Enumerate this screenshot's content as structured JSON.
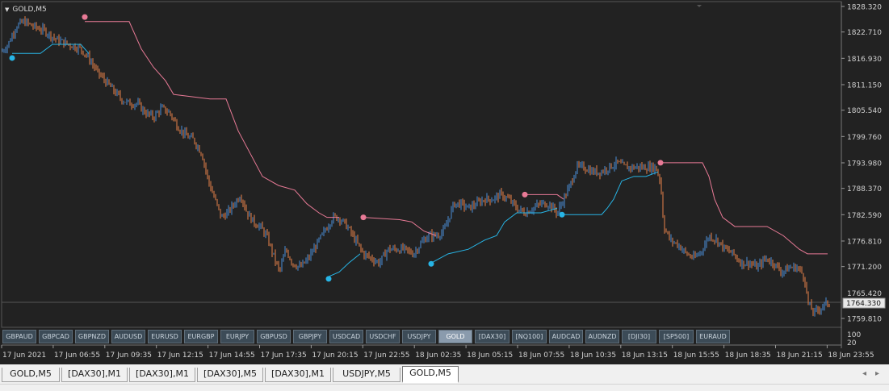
{
  "chart": {
    "title": "GOLD,M5",
    "current_price": "1764.330",
    "partial_price": "1765.420",
    "price_labels": [
      "1828.320",
      "1822.710",
      "1816.930",
      "1811.150",
      "1805.540",
      "1799.760",
      "1793.980",
      "1788.370",
      "1782.590",
      "1776.810",
      "1771.200",
      "1759.810"
    ],
    "time_labels": [
      "17 Jun 2021",
      "17 Jun 06:55",
      "17 Jun 09:35",
      "17 Jun 12:15",
      "17 Jun 14:55",
      "17 Jun 17:35",
      "17 Jun 20:15",
      "17 Jun 22:55",
      "18 Jun 02:35",
      "18 Jun 05:15",
      "18 Jun 07:55",
      "18 Jun 10:35",
      "18 Jun 13:15",
      "18 Jun 15:55",
      "18 Jun 18:35",
      "18 Jun 21:15",
      "18 Jun 23:55"
    ],
    "indicator_scale": [
      "100",
      "20"
    ],
    "colors": {
      "background": "#222222",
      "bull": "#4a8fd8",
      "bear": "#e8824a",
      "stop_up": "#27b5e6",
      "stop_down": "#e87a96"
    }
  },
  "symbols": [
    "GBPAUD",
    "GBPCAD",
    "GBPNZD",
    "AUDUSD",
    "EURUSD",
    "EURGBP",
    "EURJPY",
    "GBPUSD",
    "GBPJPY",
    "USDCAD",
    "USDCHF",
    "USDJPY",
    "GOLD",
    "[DAX30]",
    "[NQ100]",
    "AUDCAD",
    "AUDNZD",
    "[DJI30]",
    "[SP500]",
    "EURAUD"
  ],
  "active_symbol": "GOLD",
  "tabs": [
    "GOLD,M5",
    "[DAX30],M1",
    "[DAX30],M1",
    "[DAX30],M5",
    "[DAX30],M1",
    "USDJPY,M5",
    "GOLD,M5"
  ],
  "active_tab": 6,
  "tab_nav": {
    "left": "◂",
    "right": "▸"
  },
  "chart_data": {
    "type": "candlestick",
    "close_path": [
      [
        0,
        1818
      ],
      [
        10,
        1820
      ],
      [
        20,
        1824
      ],
      [
        30,
        1825
      ],
      [
        40,
        1824
      ],
      [
        55,
        1823
      ],
      [
        70,
        1821
      ],
      [
        85,
        1820
      ],
      [
        100,
        1819
      ],
      [
        110,
        1817
      ],
      [
        120,
        1814
      ],
      [
        130,
        1812
      ],
      [
        140,
        1810
      ],
      [
        150,
        1808
      ],
      [
        160,
        1807
      ],
      [
        170,
        1807
      ],
      [
        180,
        1805
      ],
      [
        190,
        1804
      ],
      [
        200,
        1806
      ],
      [
        210,
        1805
      ],
      [
        220,
        1802
      ],
      [
        230,
        1800
      ],
      [
        240,
        1799
      ],
      [
        250,
        1796
      ],
      [
        258,
        1790
      ],
      [
        266,
        1786
      ],
      [
        274,
        1782
      ],
      [
        282,
        1783
      ],
      [
        290,
        1785
      ],
      [
        298,
        1787
      ],
      [
        306,
        1783
      ],
      [
        314,
        1781
      ],
      [
        322,
        1780
      ],
      [
        330,
        1778
      ],
      [
        338,
        1774
      ],
      [
        346,
        1770
      ],
      [
        354,
        1775
      ],
      [
        362,
        1772
      ],
      [
        372,
        1771
      ],
      [
        382,
        1773
      ],
      [
        392,
        1776
      ],
      [
        402,
        1779
      ],
      [
        412,
        1782
      ],
      [
        420,
        1782
      ],
      [
        430,
        1780
      ],
      [
        440,
        1777
      ],
      [
        450,
        1774
      ],
      [
        460,
        1773
      ],
      [
        470,
        1772
      ],
      [
        480,
        1775
      ],
      [
        490,
        1775
      ],
      [
        500,
        1775
      ],
      [
        512,
        1774
      ],
      [
        520,
        1776
      ],
      [
        530,
        1778
      ],
      [
        540,
        1778
      ],
      [
        550,
        1779
      ],
      [
        556,
        1782
      ],
      [
        562,
        1785
      ],
      [
        570,
        1785
      ],
      [
        580,
        1784
      ],
      [
        590,
        1785
      ],
      [
        600,
        1786
      ],
      [
        610,
        1786
      ],
      [
        620,
        1787
      ],
      [
        630,
        1786
      ],
      [
        640,
        1784
      ],
      [
        650,
        1783
      ],
      [
        660,
        1784
      ],
      [
        670,
        1785
      ],
      [
        680,
        1785
      ],
      [
        690,
        1783
      ],
      [
        698,
        1786
      ],
      [
        706,
        1789
      ],
      [
        714,
        1793
      ],
      [
        724,
        1793
      ],
      [
        734,
        1792
      ],
      [
        744,
        1792
      ],
      [
        754,
        1793
      ],
      [
        764,
        1794
      ],
      [
        774,
        1793
      ],
      [
        784,
        1793
      ],
      [
        794,
        1793
      ],
      [
        804,
        1793
      ],
      [
        812,
        1793
      ],
      [
        818,
        1790
      ],
      [
        822,
        1780
      ],
      [
        830,
        1777
      ],
      [
        840,
        1776
      ],
      [
        850,
        1774
      ],
      [
        860,
        1773
      ],
      [
        870,
        1775
      ],
      [
        878,
        1778
      ],
      [
        888,
        1777
      ],
      [
        898,
        1775
      ],
      [
        908,
        1774
      ],
      [
        918,
        1772
      ],
      [
        928,
        1772
      ],
      [
        938,
        1771
      ],
      [
        948,
        1773
      ],
      [
        958,
        1772
      ],
      [
        968,
        1770
      ],
      [
        978,
        1771
      ],
      [
        988,
        1771
      ],
      [
        996,
        1769
      ],
      [
        1001,
        1763
      ],
      [
        1008,
        1761
      ],
      [
        1015,
        1762
      ],
      [
        1022,
        1763
      ],
      [
        1028,
        1763
      ]
    ],
    "stop_up_path": [
      [
        15,
        1818
      ],
      [
        50,
        1818
      ],
      [
        65,
        1820
      ],
      [
        100,
        1820
      ],
      [
        110,
        1818
      ]
    ],
    "stop_up_path2": [
      [
        407,
        1769
      ],
      [
        420,
        1770
      ],
      [
        432,
        1772
      ],
      [
        446,
        1774
      ]
    ],
    "stop_up_path3": [
      [
        534,
        1772
      ],
      [
        555,
        1774
      ],
      [
        580,
        1775
      ],
      [
        600,
        1777
      ],
      [
        615,
        1778
      ],
      [
        625,
        1781
      ],
      [
        640,
        1783
      ],
      [
        655,
        1783
      ],
      [
        670,
        1783
      ],
      [
        690,
        1784
      ]
    ],
    "stop_up_path4": [
      [
        696,
        1782.6
      ],
      [
        745,
        1782.6
      ],
      [
        752,
        1784
      ],
      [
        760,
        1786
      ],
      [
        770,
        1790
      ],
      [
        785,
        1791
      ],
      [
        800,
        1791
      ],
      [
        815,
        1792
      ]
    ],
    "stop_down_path": [
      [
        105,
        1825
      ],
      [
        160,
        1825
      ],
      [
        175,
        1819
      ],
      [
        190,
        1815
      ],
      [
        205,
        1812
      ],
      [
        215,
        1809
      ],
      [
        260,
        1808
      ],
      [
        280,
        1808
      ],
      [
        295,
        1801
      ],
      [
        310,
        1796
      ],
      [
        325,
        1791
      ],
      [
        345,
        1789
      ],
      [
        365,
        1788
      ],
      [
        380,
        1785
      ],
      [
        395,
        1783
      ],
      [
        405,
        1782
      ],
      [
        420,
        1782
      ]
    ],
    "stop_down_path2": [
      [
        450,
        1782
      ],
      [
        495,
        1781.5
      ],
      [
        510,
        1781
      ],
      [
        525,
        1779
      ],
      [
        540,
        1778
      ]
    ],
    "stop_down_path3": [
      [
        650,
        1787
      ],
      [
        690,
        1787
      ],
      [
        698,
        1786
      ]
    ],
    "stop_down_path4": [
      [
        818,
        1794
      ],
      [
        870,
        1794
      ],
      [
        878,
        1791
      ],
      [
        885,
        1786
      ],
      [
        895,
        1782
      ],
      [
        910,
        1780
      ],
      [
        950,
        1780
      ],
      [
        970,
        1778
      ],
      [
        990,
        1775
      ],
      [
        1000,
        1774
      ],
      [
        1025,
        1774
      ]
    ],
    "stop_markers": [
      {
        "x": 15,
        "y": 1817,
        "kind": "up"
      },
      {
        "x": 105,
        "y": 1826,
        "kind": "down"
      },
      {
        "x": 407,
        "y": 1768.5,
        "kind": "up"
      },
      {
        "x": 450,
        "y": 1782,
        "kind": "down"
      },
      {
        "x": 534,
        "y": 1771.8,
        "kind": "up"
      },
      {
        "x": 650,
        "y": 1787,
        "kind": "down"
      },
      {
        "x": 696,
        "y": 1782.6,
        "kind": "up"
      },
      {
        "x": 818,
        "y": 1794,
        "kind": "down"
      }
    ],
    "ylim": [
      1756.5,
      1829.5
    ]
  }
}
